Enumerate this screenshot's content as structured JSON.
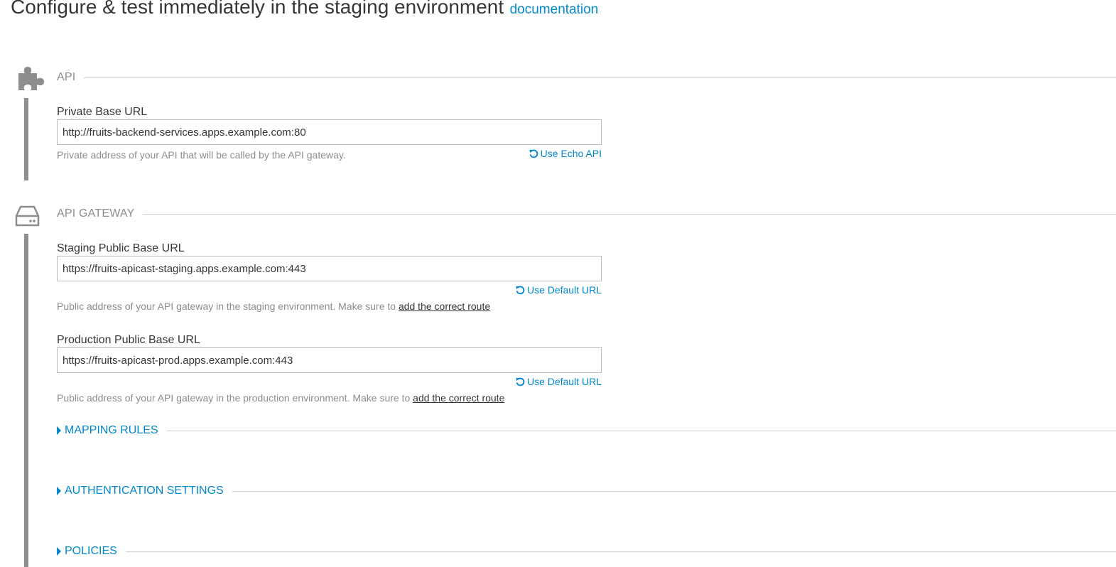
{
  "header": {
    "title": "Configure & test immediately in the staging environment",
    "doc_link": "documentation"
  },
  "api_section": {
    "icon": "puzzle-piece-icon",
    "label": "API",
    "private_base_url": {
      "label": "Private Base URL",
      "value": "http://fruits-backend-services.apps.example.com:80",
      "help": "Private address of your API that will be called by the API gateway.",
      "action": "Use Echo API"
    }
  },
  "gateway_section": {
    "icon": "server-drive-icon",
    "label": "API GATEWAY",
    "staging": {
      "label": "Staging Public Base URL",
      "value": "https://fruits-apicast-staging.apps.example.com:443",
      "action": "Use Default URL",
      "help": "Public address of your API gateway in the staging environment. Make sure to",
      "help_link": "add the correct route"
    },
    "production": {
      "label": "Production Public Base URL",
      "value": "https://fruits-apicast-prod.apps.example.com:443",
      "action": "Use Default URL",
      "help": "Public address of your API gateway in the production environment. Make sure to",
      "help_link": "add the correct route"
    }
  },
  "collapsibles": {
    "mapping_rules": "MAPPING RULES",
    "authentication": "AUTHENTICATION SETTINGS",
    "policies": "POLICIES"
  },
  "colors": {
    "link": "#0088ce",
    "muted": "#8b8d8f",
    "text": "#363636"
  }
}
